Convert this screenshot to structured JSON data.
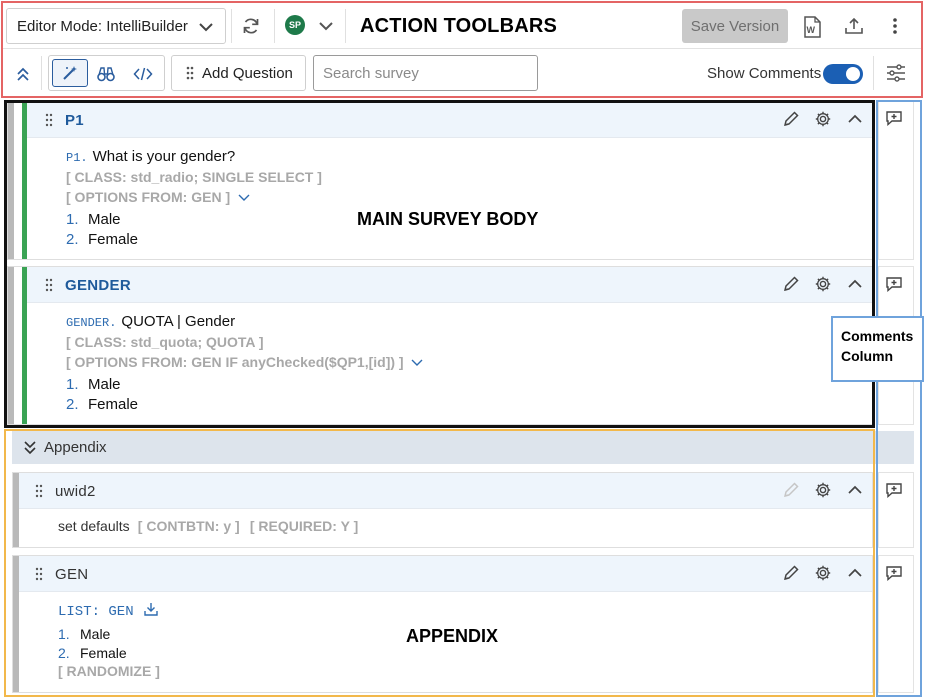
{
  "toolbar": {
    "mode_label": "Editor Mode: IntelliBuilder",
    "avatar_initials": "SP",
    "title": "ACTION TOOLBARS",
    "save_label": "Save Version",
    "add_question_label": "Add Question",
    "search_placeholder": "Search survey",
    "show_comments_label": "Show Comments",
    "show_comments_on": true
  },
  "questions": [
    {
      "name": "P1",
      "id_label": "P1.",
      "text": "What is your gender?",
      "meta": [
        "[ CLASS: std_radio; SINGLE SELECT ]",
        "[ OPTIONS FROM: GEN ]"
      ],
      "options": [
        {
          "num": "1.",
          "label": "Male"
        },
        {
          "num": "2.",
          "label": "Female"
        }
      ]
    },
    {
      "name": "GENDER",
      "id_label": "GENDER.",
      "text": "QUOTA | Gender",
      "meta": [
        "[ CLASS: std_quota; QUOTA ]",
        "[ OPTIONS FROM: GEN IF anyChecked($QP1,[id]) ]"
      ],
      "options": [
        {
          "num": "1.",
          "label": "Male"
        },
        {
          "num": "2.",
          "label": "Female"
        }
      ]
    }
  ],
  "main_label": "MAIN SURVEY BODY",
  "appendix": {
    "label": "Appendix",
    "overlay": "APPENDIX",
    "items": [
      {
        "name": "uwid2",
        "text": "set defaults",
        "meta": [
          "[ CONTBTN: y ]",
          "[ REQUIRED: Y ]"
        ]
      },
      {
        "name": "GEN",
        "list_label": "LIST: GEN",
        "options": [
          {
            "num": "1.",
            "label": "Male"
          },
          {
            "num": "2.",
            "label": "Female"
          }
        ],
        "meta": "[ RANDOMIZE ]"
      }
    ]
  },
  "comments_column": {
    "line1": "Comments",
    "line2": "Column"
  },
  "colors": {
    "green_bar": "#3aa354",
    "gray_bar": "#b9b9b9",
    "accent": "#1b5fb4"
  }
}
